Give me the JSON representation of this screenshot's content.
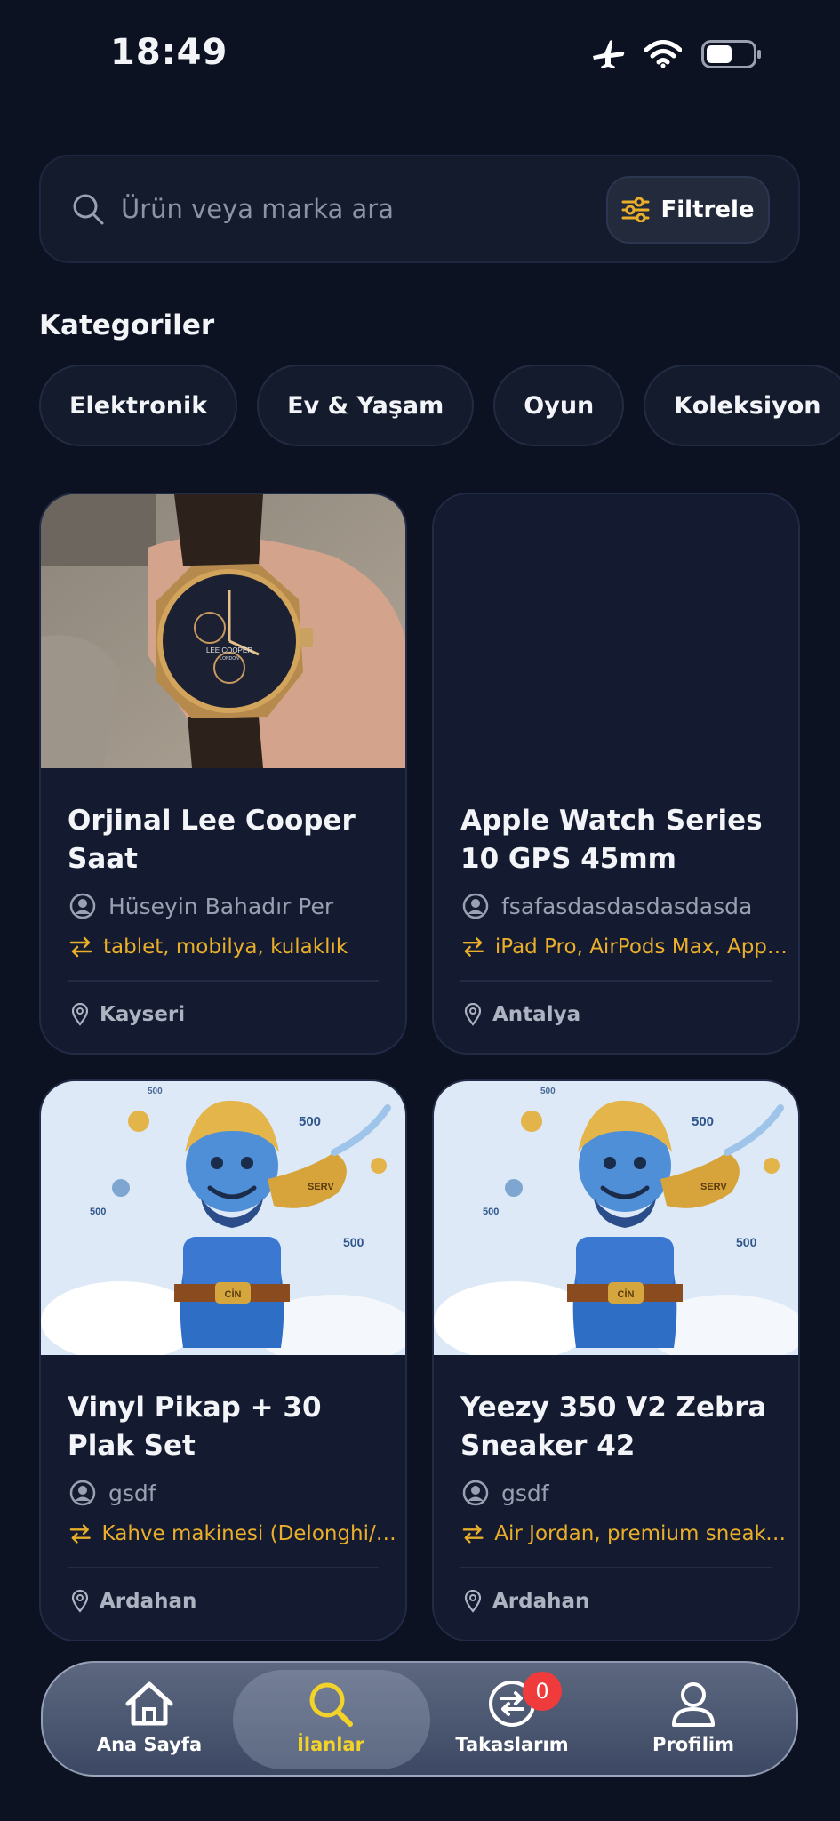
{
  "status": {
    "time": "18:49"
  },
  "search": {
    "placeholder": "Ürün veya marka ara",
    "filter_label": "Filtrele"
  },
  "categories": {
    "title": "Kategoriler",
    "items": [
      "Elektronik",
      "Ev & Yaşam",
      "Oyun",
      "Koleksiyon"
    ]
  },
  "listings": [
    {
      "title": "Orjinal Lee Cooper Saat",
      "owner": "Hüseyin Bahadır Per",
      "wants": "tablet, mobilya, kulaklık",
      "location": "Kayseri",
      "image": "watch-photo",
      "watch_brand": "LEE COOPER",
      "watch_sub": "LONDON"
    },
    {
      "title": "Apple Watch Series 10 GPS 45mm",
      "owner": "fsafasdasdasdasdasda",
      "wants": "iPad Pro, AirPods Max, Apple...",
      "location": "Antalya",
      "image": "none"
    },
    {
      "title": "Vinyl Pikap + 30 Plak Set",
      "owner": "gsdf",
      "wants": "Kahve makinesi (Delonghi/Br...",
      "location": "Ardahan",
      "image": "genie-illustration"
    },
    {
      "title": "Yeezy 350 V2 Zebra Sneaker 42",
      "owner": "gsdf",
      "wants": "Air Jordan, premium sneaker,...",
      "location": "Ardahan",
      "image": "genie-illustration"
    }
  ],
  "genie_art": {
    "lamp_text": "SERV",
    "belt_text": "CİN",
    "numbers": [
      "500",
      "500",
      "500",
      "500"
    ]
  },
  "tabbar": {
    "tabs": [
      {
        "label": "Ana Sayfa",
        "icon": "home-icon"
      },
      {
        "label": "İlanlar",
        "icon": "search-icon",
        "active": true
      },
      {
        "label": "Takaslarım",
        "icon": "swap-icon",
        "badge": "0"
      },
      {
        "label": "Profilim",
        "icon": "profile-icon"
      }
    ]
  },
  "colors": {
    "background": "#0c1222",
    "accent": "#e9ae2a",
    "active_tab": "#f3d22a",
    "badge": "#ef3b3b"
  }
}
